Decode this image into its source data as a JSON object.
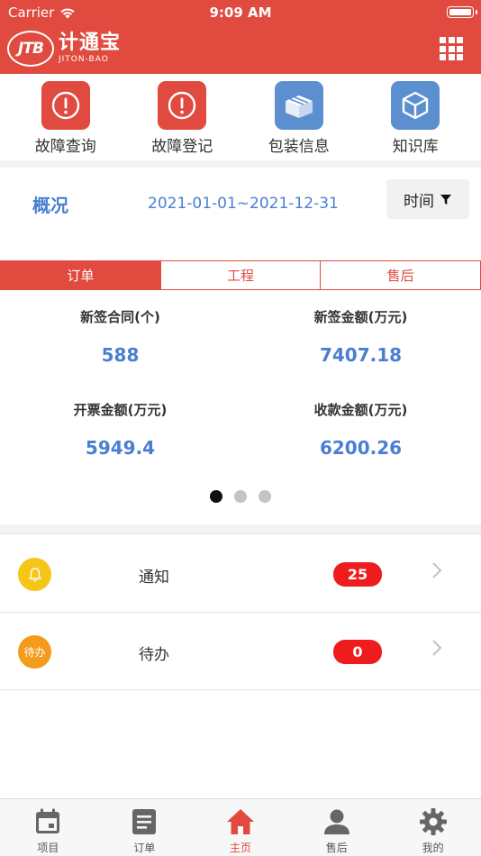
{
  "status_bar": {
    "carrier": "Carrier",
    "time": "9:09 AM"
  },
  "header": {
    "logo_badge": "JTB",
    "logo_cn": "计通宝",
    "logo_en": "JITON-BAO"
  },
  "quick_actions": [
    {
      "label": "故障查询",
      "icon": "alert-icon"
    },
    {
      "label": "故障登记",
      "icon": "alert-icon"
    },
    {
      "label": "包装信息",
      "icon": "package-icon"
    },
    {
      "label": "知识库",
      "icon": "cube-icon"
    }
  ],
  "overview": {
    "title": "概况",
    "date_range": "2021-01-01~2021-12-31",
    "time_button": "时间"
  },
  "tabs": [
    {
      "label": "订单",
      "active": true
    },
    {
      "label": "工程",
      "active": false
    },
    {
      "label": "售后",
      "active": false
    }
  ],
  "stats": [
    {
      "label": "新签合同(个)",
      "value": "588"
    },
    {
      "label": "新签金额(万元)",
      "value": "7407.18"
    },
    {
      "label": "开票金额(万元)",
      "value": "5949.4"
    },
    {
      "label": "收款金额(万元)",
      "value": "6200.26"
    }
  ],
  "pager": {
    "current": 1,
    "total": 3
  },
  "list": [
    {
      "label": "通知",
      "count": "25",
      "icon_text": ""
    },
    {
      "label": "待办",
      "count": "0",
      "icon_text": "待办"
    }
  ],
  "tabbar": [
    {
      "label": "项目",
      "active": false
    },
    {
      "label": "订单",
      "active": false
    },
    {
      "label": "主页",
      "active": true
    },
    {
      "label": "售后",
      "active": false
    },
    {
      "label": "我的",
      "active": false
    }
  ],
  "colors": {
    "brand_red": "#e04a3f",
    "accent_blue": "#4a7fd0",
    "badge_red": "#ee1c1c",
    "icon_gray": "#666666"
  }
}
